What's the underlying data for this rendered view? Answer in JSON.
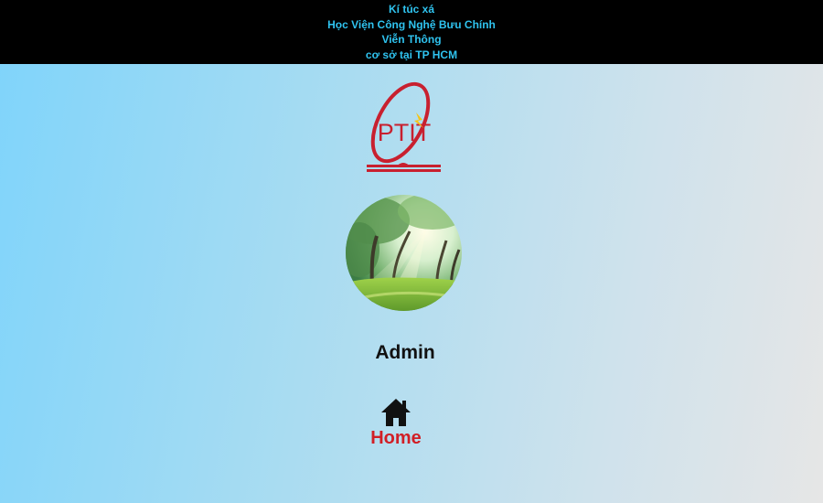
{
  "header": {
    "line1": "Kí túc xá",
    "line2": "Học Viện Công Nghệ Bưu Chính",
    "line3": "Viễn Thông",
    "line4": "cơ sở tại TP HCM",
    "text_color": "#2fc3ef",
    "background": "#000000"
  },
  "logo": {
    "text": "PTIT",
    "icon": "ptit-logo",
    "color": "#c8202f",
    "accent": "#f5c518"
  },
  "profile": {
    "avatar_icon": "forest-avatar",
    "username": "Admin"
  },
  "nav": {
    "home_label": "Home",
    "home_icon": "home-icon",
    "home_color": "#d11f26"
  }
}
